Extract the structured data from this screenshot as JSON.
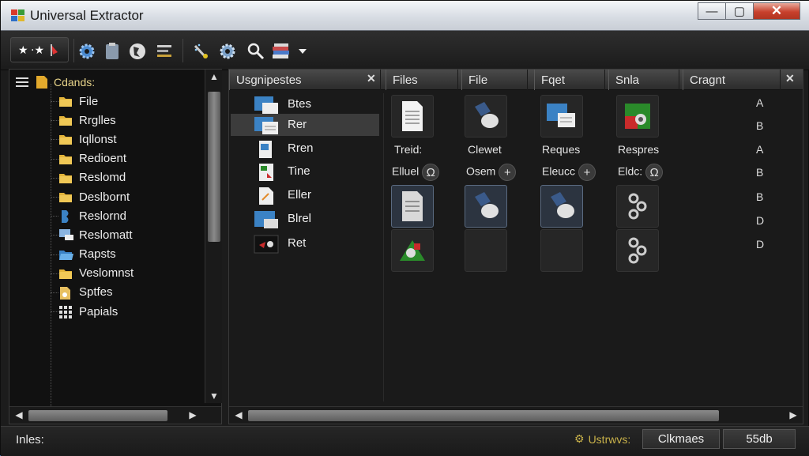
{
  "window": {
    "title": "Universal Extractor",
    "controls": {
      "minimize": "—",
      "maximize": "▢",
      "close": "✕"
    }
  },
  "toolbar": {
    "icons": [
      "toolbar-run-icon",
      "gear-icon",
      "clipboard-icon",
      "globe-icon",
      "list-icon",
      "wand-icon",
      "gear-icon",
      "search-icon",
      "books-icon",
      "chevron-down-icon"
    ]
  },
  "tree": {
    "root_label": "Cdands:",
    "items": [
      {
        "label": "File",
        "icon": "folder-icon"
      },
      {
        "label": "Rrglles",
        "icon": "folder-icon"
      },
      {
        "label": "Iqllonst",
        "icon": "folder-icon"
      },
      {
        "label": "Redioent",
        "icon": "folder-icon"
      },
      {
        "label": "Reslomd",
        "icon": "folder-icon"
      },
      {
        "label": "Deslbornt",
        "icon": "folder-icon"
      },
      {
        "label": "Reslornd",
        "icon": "bookmark-icon"
      },
      {
        "label": "Reslomatt",
        "icon": "computer-icon"
      },
      {
        "label": "Rapsts",
        "icon": "folder-open-icon"
      },
      {
        "label": "Veslomnst",
        "icon": "folder-icon"
      },
      {
        "label": "Sptfes",
        "icon": "document-icon"
      },
      {
        "label": "Papials",
        "icon": "grid-icon"
      }
    ]
  },
  "columns": {
    "c1": "Usgnipestes",
    "c2": "Files",
    "c3": "File",
    "c4": "Fqet",
    "c5": "Snla",
    "c6": "Cragnt"
  },
  "files": [
    {
      "label": "Btes"
    },
    {
      "label": "Rer"
    },
    {
      "label": "Rren"
    },
    {
      "label": "Tine"
    },
    {
      "label": "Eller"
    },
    {
      "label": "Blrel"
    },
    {
      "label": "Ret"
    }
  ],
  "grid": {
    "row1_text": [
      "Treid:",
      "Clewet",
      "Reques",
      "Respres"
    ],
    "row2_text": [
      "Elluel",
      "Osem",
      "Eleucc",
      "Eldc:"
    ],
    "row2_btns": [
      "Ω",
      "+",
      "+",
      "Ω"
    ]
  },
  "letters": [
    "A",
    "B",
    "A",
    "B",
    "B",
    "D",
    "D"
  ],
  "status": {
    "left": "Inles:",
    "mid": "Ustrwvs:",
    "box1": "Clkmaes",
    "box2": "55db"
  }
}
